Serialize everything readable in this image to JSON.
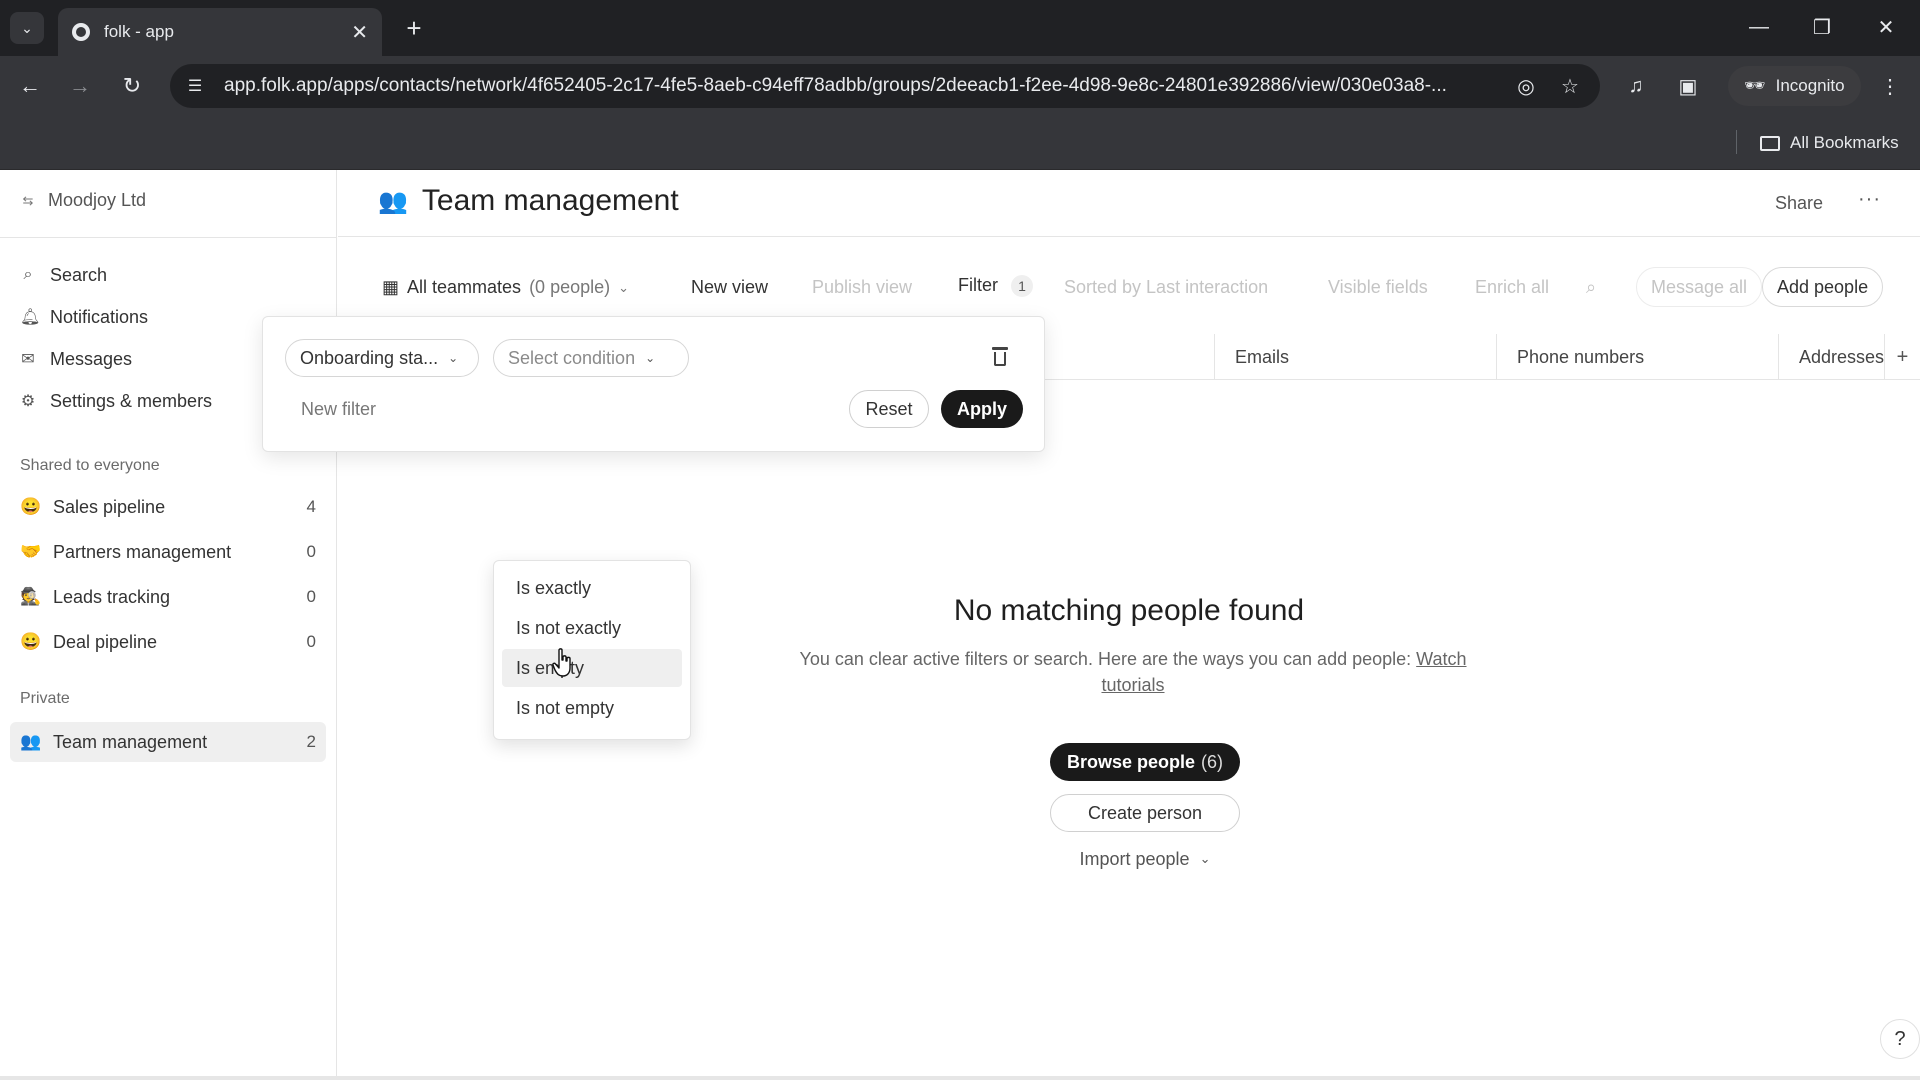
{
  "browser": {
    "tab_title": "folk - app",
    "url": "app.folk.app/apps/contacts/network/4f652405-2c17-4fe5-8aeb-c94eff78adbb/groups/2deeacb1-f2ee-4d98-9e8c-24801e392886/view/030e03a8-...",
    "incognito_label": "Incognito",
    "bookmarks_label": "All Bookmarks"
  },
  "sidebar": {
    "workspace": "Moodjoy Ltd",
    "nav": [
      {
        "label": "Search",
        "icon": "search-icon"
      },
      {
        "label": "Notifications",
        "icon": "bell-icon"
      },
      {
        "label": "Messages",
        "icon": "mail-icon"
      },
      {
        "label": "Settings & members",
        "icon": "gear-icon"
      }
    ],
    "shared_heading": "Shared to everyone",
    "shared_groups": [
      {
        "emoji": "😀",
        "name": "Sales pipeline",
        "count": "4"
      },
      {
        "emoji": "🤝",
        "name": "Partners management",
        "count": "0"
      },
      {
        "emoji": "🕵",
        "name": "Leads tracking",
        "count": "0"
      },
      {
        "emoji": "😀",
        "name": "Deal pipeline",
        "count": "0"
      }
    ],
    "private_heading": "Private",
    "private_groups": [
      {
        "emoji": "👥",
        "name": "Team management",
        "count": "2"
      }
    ]
  },
  "header": {
    "title": "Team management",
    "share": "Share",
    "more": "···"
  },
  "viewbar": {
    "view_name": "All teammates",
    "view_count": "(0 people)",
    "new_view": "New view",
    "publish_view": "Publish view",
    "filter": "Filter",
    "filter_count": "1",
    "sorted": "Sorted by Last interaction",
    "visible_fields": "Visible fields",
    "enrich_all": "Enrich all",
    "message_all": "Message all",
    "add_people": "Add people"
  },
  "columns": [
    "Emails",
    "Phone numbers",
    "Addresses"
  ],
  "empty": {
    "title": "No matching people found",
    "desc": "You can clear active filters or search. Here are the ways you can add people:",
    "link": "Watch tutorials",
    "browse_label": "Browse people",
    "browse_count": "(6)",
    "create_label": "Create person",
    "import_label": "Import people"
  },
  "filter_popover": {
    "field_value": "Onboarding sta...",
    "condition_placeholder": "Select condition",
    "new_filter": "New filter",
    "reset": "Reset",
    "apply": "Apply",
    "condition_options": [
      "Is exactly",
      "Is not exactly",
      "Is empty",
      "Is not empty"
    ],
    "hovered_option": "Is empty"
  },
  "help": "?"
}
